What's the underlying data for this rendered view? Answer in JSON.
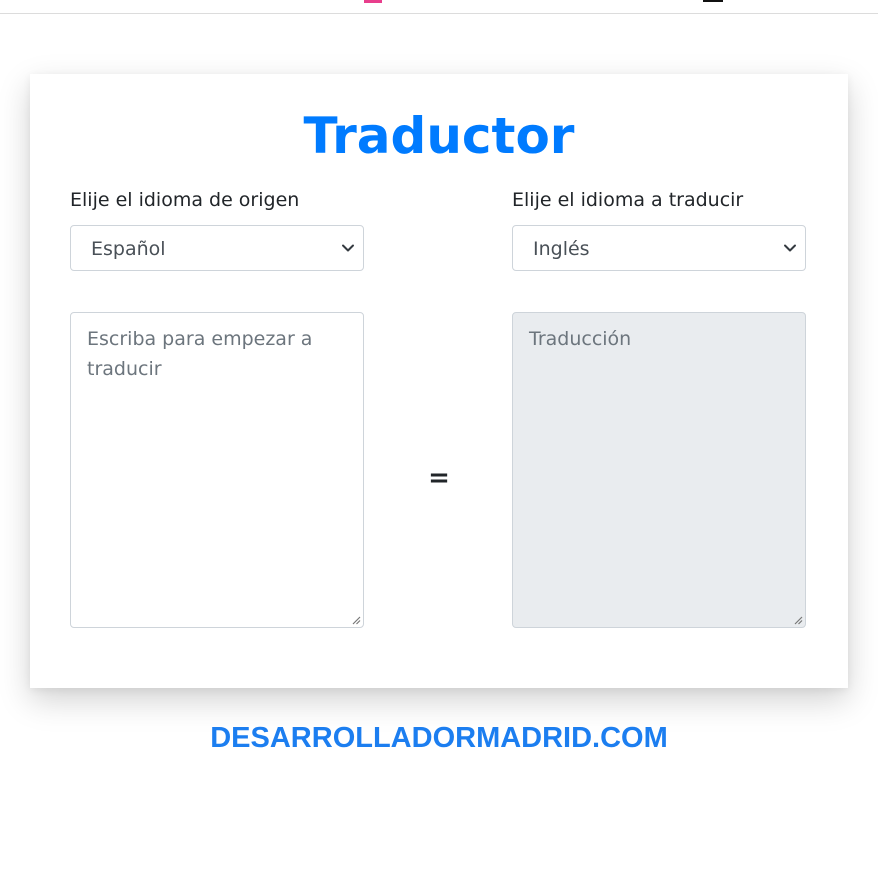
{
  "app": {
    "title": "Traductor",
    "accent_color": "#007bff"
  },
  "source": {
    "label": "Elije el idioma de origen",
    "selected_language": "Español",
    "input_placeholder": "Escriba para empezar a traducir"
  },
  "target": {
    "label": "Elije el idioma a traducir",
    "selected_language": "Inglés",
    "output_placeholder": "Traducción"
  },
  "separator": "=",
  "footer": {
    "text": "DESARROLLADORMADRID.COM"
  },
  "icons": {
    "select_arrow": "chevron-down-icon",
    "resize_handle": "resize-grip-icon"
  }
}
